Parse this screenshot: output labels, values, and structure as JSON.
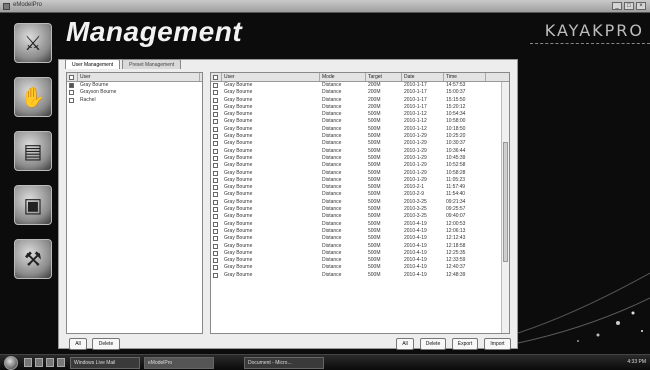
{
  "window": {
    "title": "eModelPro",
    "buttons": [
      "_",
      "□",
      "×"
    ]
  },
  "header": {
    "title": "Management",
    "brand": "KAYAKPRO"
  },
  "sidebar": {
    "items": [
      {
        "icon": "rowing-icon",
        "glyph": "⚔"
      },
      {
        "icon": "hand-icon",
        "glyph": "✋"
      },
      {
        "icon": "display-icon",
        "glyph": "▤"
      },
      {
        "icon": "camera-icon",
        "glyph": "▣"
      },
      {
        "icon": "tools-icon",
        "glyph": "⚒"
      }
    ]
  },
  "tabs": [
    {
      "label": "User Management",
      "active": true
    },
    {
      "label": "Preset Management",
      "active": false
    }
  ],
  "users_list": {
    "header": "User",
    "rows": [
      {
        "name": "Gray Bourne",
        "checked": true
      },
      {
        "name": "Grayson Bourne",
        "checked": false
      },
      {
        "name": "Rachel",
        "checked": false
      }
    ]
  },
  "sessions": {
    "columns": [
      "User",
      "Mode",
      "Target",
      "Date",
      "Time"
    ],
    "rows": [
      {
        "user": "Gray Bourne",
        "mode": "Distance",
        "target": "200M",
        "date": "2010-1-17",
        "time": "14:57:53"
      },
      {
        "user": "Gray Bourne",
        "mode": "Distance",
        "target": "200M",
        "date": "2010-1-17",
        "time": "15:00:37"
      },
      {
        "user": "Gray Bourne",
        "mode": "Distance",
        "target": "200M",
        "date": "2010-1-17",
        "time": "15:15:50"
      },
      {
        "user": "Gray Bourne",
        "mode": "Distance",
        "target": "200M",
        "date": "2010-1-17",
        "time": "15:20:12"
      },
      {
        "user": "Gray Bourne",
        "mode": "Distance",
        "target": "500M",
        "date": "2010-1-12",
        "time": "10:54:34"
      },
      {
        "user": "Gray Bourne",
        "mode": "Distance",
        "target": "500M",
        "date": "2010-1-12",
        "time": "10:58:00"
      },
      {
        "user": "Gray Bourne",
        "mode": "Distance",
        "target": "500M",
        "date": "2010-1-12",
        "time": "10:18:50"
      },
      {
        "user": "Gray Bourne",
        "mode": "Distance",
        "target": "500M",
        "date": "2010-1-29",
        "time": "10:25:20"
      },
      {
        "user": "Gray Bourne",
        "mode": "Distance",
        "target": "500M",
        "date": "2010-1-29",
        "time": "10:30:37"
      },
      {
        "user": "Gray Bourne",
        "mode": "Distance",
        "target": "500M",
        "date": "2010-1-29",
        "time": "10:36:44"
      },
      {
        "user": "Gray Bourne",
        "mode": "Distance",
        "target": "500M",
        "date": "2010-1-29",
        "time": "10:45:39"
      },
      {
        "user": "Gray Bourne",
        "mode": "Distance",
        "target": "500M",
        "date": "2010-1-29",
        "time": "10:52:58"
      },
      {
        "user": "Gray Bourne",
        "mode": "Distance",
        "target": "500M",
        "date": "2010-1-29",
        "time": "10:58:28"
      },
      {
        "user": "Gray Bourne",
        "mode": "Distance",
        "target": "500M",
        "date": "2010-1-29",
        "time": "11:05:23"
      },
      {
        "user": "Gray Bourne",
        "mode": "Distance",
        "target": "500M",
        "date": "2010-2-1",
        "time": "11:57:49"
      },
      {
        "user": "Gray Bourne",
        "mode": "Distance",
        "target": "500M",
        "date": "2010-2-9",
        "time": "11:54:40"
      },
      {
        "user": "Gray Bourne",
        "mode": "Distance",
        "target": "500M",
        "date": "2010-3-25",
        "time": "09:21:34"
      },
      {
        "user": "Gray Bourne",
        "mode": "Distance",
        "target": "500M",
        "date": "2010-3-25",
        "time": "09:25:57"
      },
      {
        "user": "Gray Bourne",
        "mode": "Distance",
        "target": "500M",
        "date": "2010-3-25",
        "time": "09:40:07"
      },
      {
        "user": "Gray Bourne",
        "mode": "Distance",
        "target": "500M",
        "date": "2010-4-19",
        "time": "12:00:53"
      },
      {
        "user": "Gray Bourne",
        "mode": "Distance",
        "target": "500M",
        "date": "2010-4-19",
        "time": "12:06:13"
      },
      {
        "user": "Gray Bourne",
        "mode": "Distance",
        "target": "500M",
        "date": "2010-4-19",
        "time": "12:12:43"
      },
      {
        "user": "Gray Bourne",
        "mode": "Distance",
        "target": "500M",
        "date": "2010-4-19",
        "time": "12:18:58"
      },
      {
        "user": "Gray Bourne",
        "mode": "Distance",
        "target": "500M",
        "date": "2010-4-19",
        "time": "12:25:35"
      },
      {
        "user": "Gray Bourne",
        "mode": "Distance",
        "target": "500M",
        "date": "2010-4-19",
        "time": "12:33:59"
      },
      {
        "user": "Gray Bourne",
        "mode": "Distance",
        "target": "500M",
        "date": "2010-4-19",
        "time": "12:40:37"
      },
      {
        "user": "Gray Bourne",
        "mode": "Distance",
        "target": "500M",
        "date": "2010-4-19",
        "time": "12:48:39"
      }
    ]
  },
  "buttons": {
    "users_all": "All",
    "users_delete": "Delete",
    "sessions_all": "All",
    "sessions_delete": "Delete",
    "export": "Export",
    "import": "Import"
  },
  "taskbar": {
    "items": [
      "Windows Live Mail",
      "eModelPro",
      "Document - Micro..."
    ],
    "time": "4:33 PM"
  }
}
